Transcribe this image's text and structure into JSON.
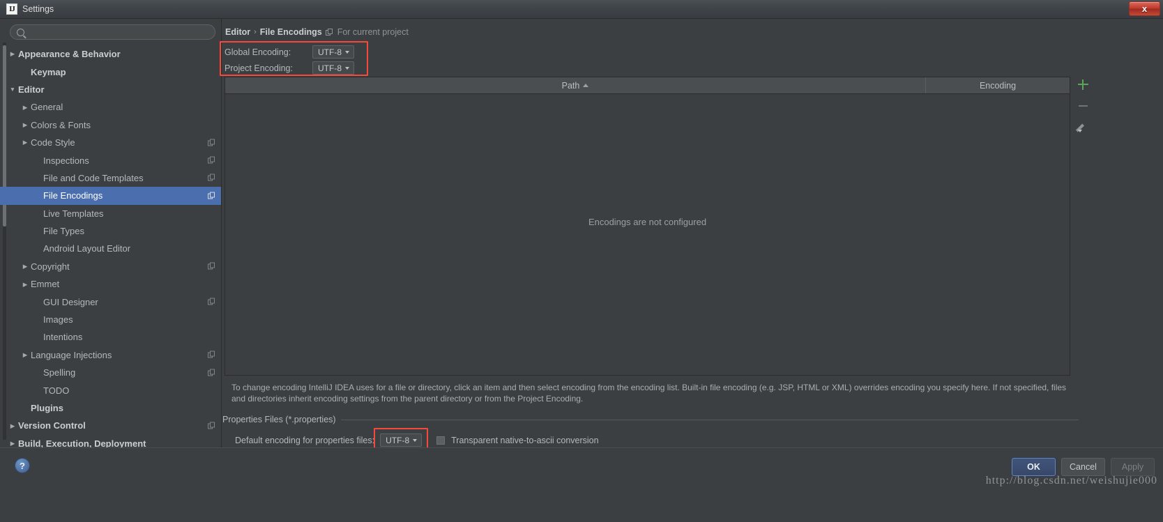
{
  "window": {
    "title": "Settings",
    "logo_text": "IJ",
    "close_label": "x"
  },
  "search": {
    "value": "",
    "placeholder": "",
    "icon": "search-icon"
  },
  "sidebar": {
    "items": [
      {
        "label": "Appearance & Behavior",
        "arrow": "▶",
        "indent": 0,
        "bold": true,
        "badge": false,
        "selected": false
      },
      {
        "label": "Keymap",
        "arrow": "",
        "indent": 1,
        "bold": true,
        "badge": false,
        "selected": false
      },
      {
        "label": "Editor",
        "arrow": "▼",
        "indent": 0,
        "bold": true,
        "badge": false,
        "selected": false
      },
      {
        "label": "General",
        "arrow": "▶",
        "indent": 1,
        "bold": false,
        "badge": false,
        "selected": false
      },
      {
        "label": "Colors & Fonts",
        "arrow": "▶",
        "indent": 1,
        "bold": false,
        "badge": false,
        "selected": false
      },
      {
        "label": "Code Style",
        "arrow": "▶",
        "indent": 1,
        "bold": false,
        "badge": true,
        "selected": false
      },
      {
        "label": "Inspections",
        "arrow": "",
        "indent": 2,
        "bold": false,
        "badge": true,
        "selected": false
      },
      {
        "label": "File and Code Templates",
        "arrow": "",
        "indent": 2,
        "bold": false,
        "badge": true,
        "selected": false
      },
      {
        "label": "File Encodings",
        "arrow": "",
        "indent": 2,
        "bold": false,
        "badge": true,
        "selected": true
      },
      {
        "label": "Live Templates",
        "arrow": "",
        "indent": 2,
        "bold": false,
        "badge": false,
        "selected": false
      },
      {
        "label": "File Types",
        "arrow": "",
        "indent": 2,
        "bold": false,
        "badge": false,
        "selected": false
      },
      {
        "label": "Android Layout Editor",
        "arrow": "",
        "indent": 2,
        "bold": false,
        "badge": false,
        "selected": false
      },
      {
        "label": "Copyright",
        "arrow": "▶",
        "indent": 1,
        "bold": false,
        "badge": true,
        "selected": false
      },
      {
        "label": "Emmet",
        "arrow": "▶",
        "indent": 1,
        "bold": false,
        "badge": false,
        "selected": false
      },
      {
        "label": "GUI Designer",
        "arrow": "",
        "indent": 2,
        "bold": false,
        "badge": true,
        "selected": false
      },
      {
        "label": "Images",
        "arrow": "",
        "indent": 2,
        "bold": false,
        "badge": false,
        "selected": false
      },
      {
        "label": "Intentions",
        "arrow": "",
        "indent": 2,
        "bold": false,
        "badge": false,
        "selected": false
      },
      {
        "label": "Language Injections",
        "arrow": "▶",
        "indent": 1,
        "bold": false,
        "badge": true,
        "selected": false
      },
      {
        "label": "Spelling",
        "arrow": "",
        "indent": 2,
        "bold": false,
        "badge": true,
        "selected": false
      },
      {
        "label": "TODO",
        "arrow": "",
        "indent": 2,
        "bold": false,
        "badge": false,
        "selected": false
      },
      {
        "label": "Plugins",
        "arrow": "",
        "indent": 1,
        "bold": true,
        "badge": false,
        "selected": false
      },
      {
        "label": "Version Control",
        "arrow": "▶",
        "indent": 0,
        "bold": true,
        "badge": true,
        "selected": false
      },
      {
        "label": "Build, Execution, Deployment",
        "arrow": "▶",
        "indent": 0,
        "bold": true,
        "badge": false,
        "selected": false
      }
    ]
  },
  "breadcrumb": {
    "parent": "Editor",
    "separator": "›",
    "current": "File Encodings",
    "scope_note": "For current project",
    "scope_icon": "project-scope-icon"
  },
  "encodings": {
    "global_label": "Global Encoding:",
    "global_value": "UTF-8",
    "project_label": "Project Encoding:",
    "project_value": "UTF-8"
  },
  "table": {
    "columns": [
      "Path",
      "Encoding"
    ],
    "sort_column": "Path",
    "sort_direction": "ascending",
    "rows": [],
    "empty_message": "Encodings are not configured"
  },
  "table_tools": {
    "add": "add-icon",
    "remove": "remove-icon",
    "edit": "edit-pencil-icon"
  },
  "description": "To change encoding IntelliJ IDEA uses for a file or directory, click an item and then select encoding from the encoding list. Built-in file encoding (e.g. JSP, HTML or XML) overrides encoding you specify here. If not specified, files and directories inherit encoding settings from the parent directory or from the Project Encoding.",
  "properties_section": {
    "title": "Properties Files (*.properties)",
    "default_encoding_label": "Default encoding for properties files:",
    "default_encoding_value": "UTF-8",
    "transparent_checkbox_label": "Transparent native-to-ascii conversion",
    "transparent_checked": false
  },
  "footer": {
    "help": "?",
    "ok": "OK",
    "cancel": "Cancel",
    "apply": "Apply"
  },
  "watermark": "http://blog.csdn.net/weishujie000",
  "colors": {
    "accent_selection": "#4b6eaf",
    "highlight_red": "#f4493c",
    "add_green": "#5aa55a",
    "panel_bg": "#3c3f41"
  }
}
